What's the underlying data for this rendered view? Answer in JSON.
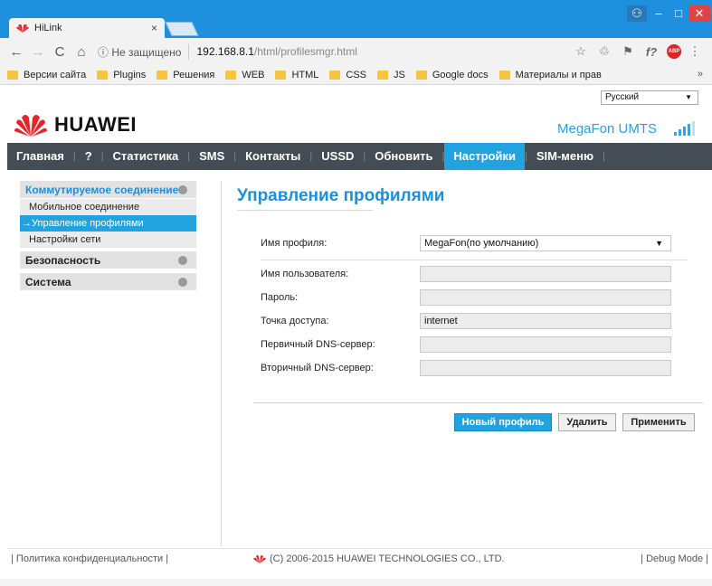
{
  "browser": {
    "tab_title": "HiLink",
    "tab_close": "×",
    "address_security": "ⓘ Не защищено",
    "address_host": "192.168.8.1",
    "address_path": "/html/profilesmgr.html",
    "bookmarks": [
      "Версии сайта",
      "Plugins",
      "Решения",
      "WEB",
      "HTML",
      "CSS",
      "JS",
      "Google docs",
      "Материалы и прав"
    ],
    "bookmarks_more": "»",
    "abp_label": "ABP"
  },
  "header": {
    "language": "Русский",
    "brand": "HUAWEI",
    "operator": "MegaFon  UMTS"
  },
  "nav": {
    "items": [
      "Главная",
      "?",
      "Статистика",
      "SMS",
      "Контакты",
      "USSD",
      "Обновить",
      "Настройки",
      "SIM-меню"
    ],
    "active": "Настройки"
  },
  "sidebar": {
    "group1": "Коммутируемое соединение",
    "sub1": "Мобильное соединение",
    "sub2": "→Управление профилями",
    "sub3": "Настройки сети",
    "group2": "Безопасность",
    "group3": "Система"
  },
  "form": {
    "title": "Управление профилями",
    "profile_label": "Имя профиля:",
    "profile_value": "MegaFon(по умолчанию)",
    "user_label": "Имя пользователя:",
    "user_value": "",
    "password_label": "Пароль:",
    "password_value": "",
    "apn_label": "Точка доступа:",
    "apn_value": "internet",
    "dns1_label": "Первичный DNS-сервер:",
    "dns1_value": "",
    "dns2_label": "Вторичный DNS-сервер:",
    "dns2_value": "",
    "btn_new": "Новый профиль",
    "btn_delete": "Удалить",
    "btn_apply": "Применить"
  },
  "footer": {
    "privacy": "| Политика конфиденциальности |",
    "copyright": "(C) 2006-2015 HUAWEI TECHNOLOGIES CO., LTD.",
    "debug": "| Debug Mode |"
  },
  "colors": {
    "accent": "#21a3e0",
    "titlebar": "#1e90dd",
    "nav_bg": "#444d55",
    "brand_red": "#e3262b"
  }
}
